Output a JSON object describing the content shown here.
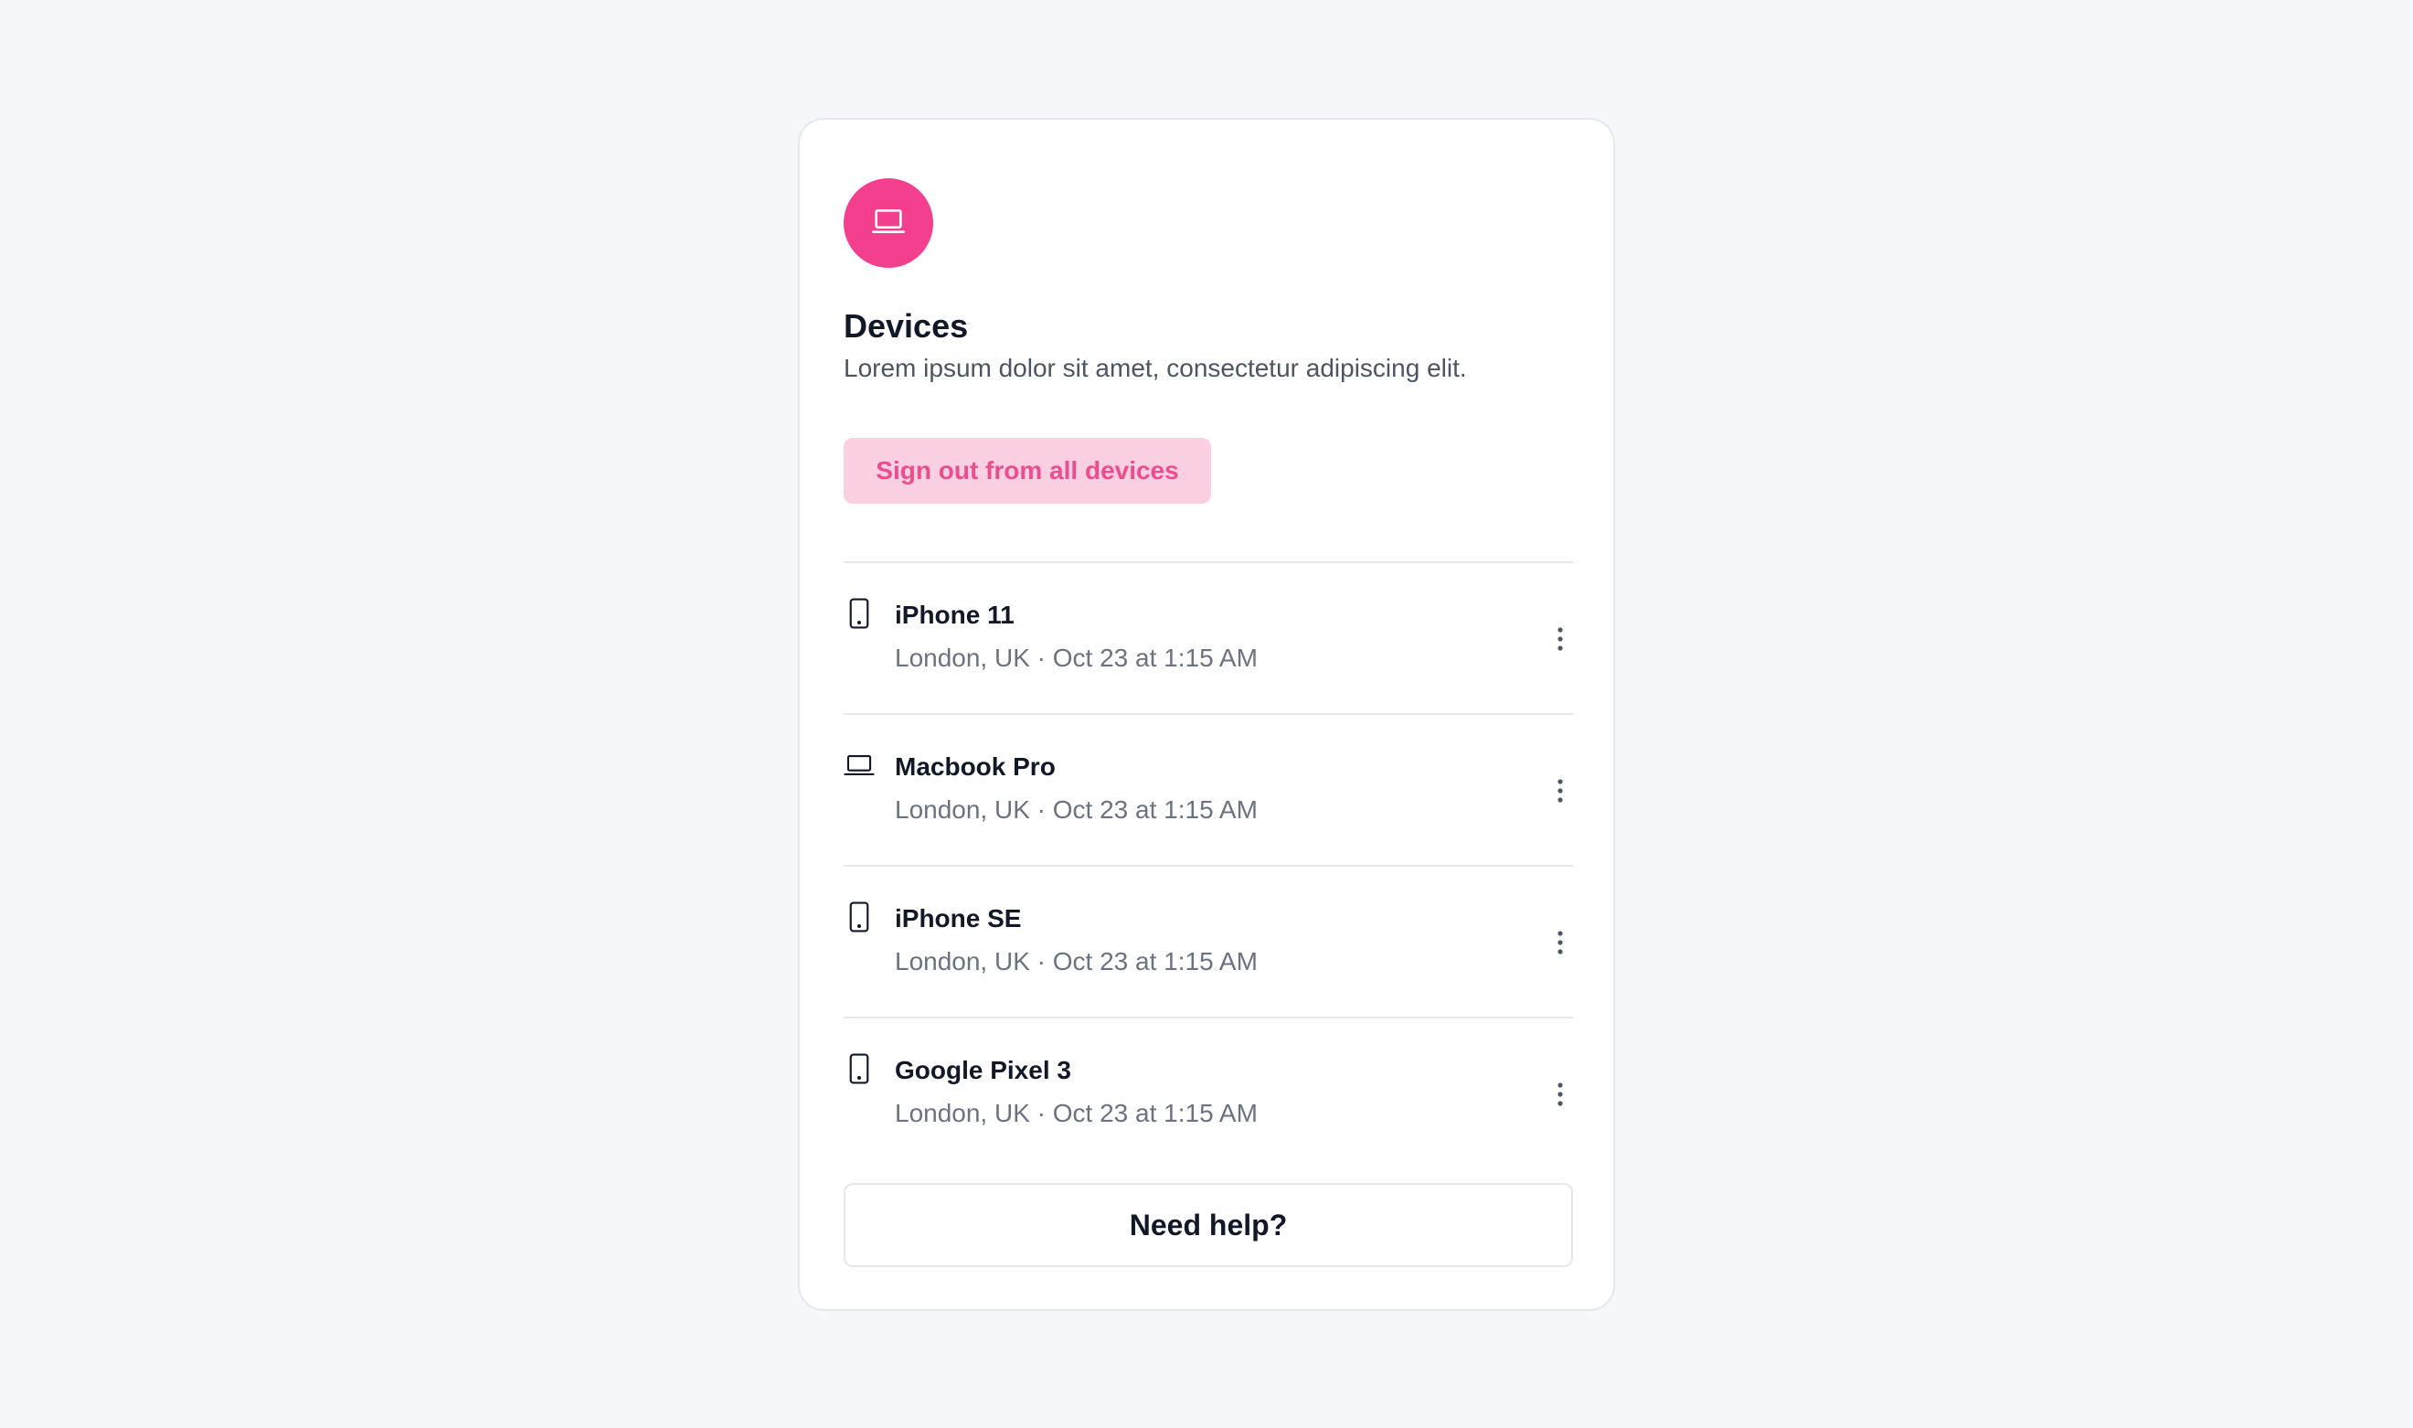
{
  "header": {
    "icon": "laptop-icon",
    "accent_color": "#f43f8e",
    "title": "Devices",
    "description": "Lorem ipsum dolor sit amet, consectetur adipiscing elit."
  },
  "actions": {
    "sign_out_all_label": "Sign out from all devices",
    "help_label": "Need help?"
  },
  "devices": [
    {
      "icon": "phone-icon",
      "name": "iPhone 11",
      "meta": "London, UK · Oct 23 at 1:15 AM"
    },
    {
      "icon": "laptop-icon",
      "name": "Macbook Pro",
      "meta": "London, UK · Oct 23 at 1:15 AM"
    },
    {
      "icon": "phone-icon",
      "name": "iPhone SE",
      "meta": "London, UK · Oct 23 at 1:15 AM"
    },
    {
      "icon": "phone-icon",
      "name": "Google Pixel 3",
      "meta": "London, UK · Oct 23 at 1:15 AM"
    }
  ]
}
